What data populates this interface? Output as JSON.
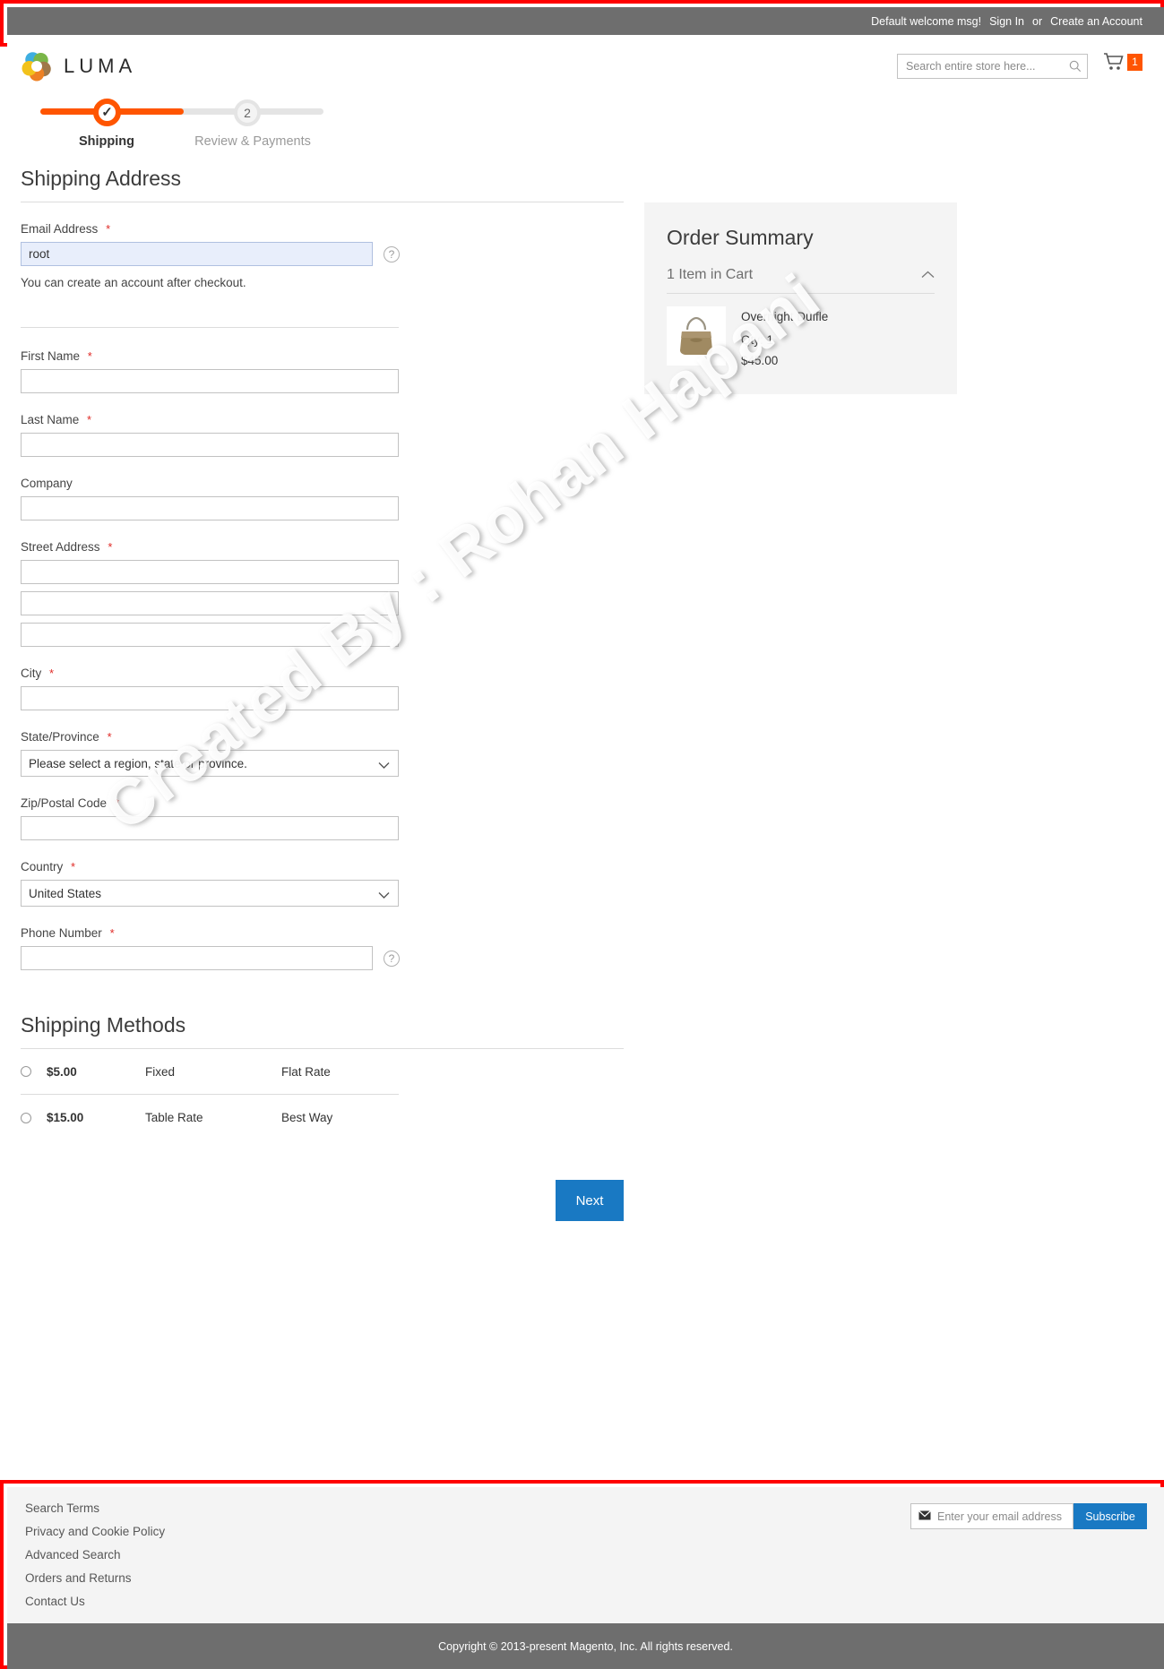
{
  "top_panel": {
    "welcome_message": "Default welcome msg!",
    "sign_in": "Sign In",
    "or": "or",
    "create_account": "Create an Account"
  },
  "header": {
    "logo_text": "LUMA",
    "search_placeholder": "Search entire store here...",
    "search_value": "",
    "cart_count": "1"
  },
  "progress": {
    "step1_label": "Shipping",
    "step1_mark": "✓",
    "step2_label": "Review & Payments",
    "step2_number": "2"
  },
  "shipping_address": {
    "heading": "Shipping Address",
    "email_label": "Email Address",
    "email_value": "root",
    "email_placeholder": "",
    "email_hint": "You can create an account after checkout.",
    "first_name_label": "First Name",
    "first_name_value": "",
    "last_name_label": "Last Name",
    "last_name_value": "",
    "company_label": "Company",
    "company_value": "",
    "street_label": "Street Address",
    "street_line1": "",
    "street_line2": "",
    "street_line3": "",
    "city_label": "City",
    "city_value": "",
    "state_label": "State/Province",
    "state_value": "Please select a region, state or province.",
    "zip_label": "Zip/Postal Code",
    "zip_value": "",
    "country_label": "Country",
    "country_value": "United States",
    "phone_label": "Phone Number",
    "phone_value": "",
    "required_marker": "*"
  },
  "shipping_methods": {
    "heading": "Shipping Methods",
    "rows": [
      {
        "price": "$5.00",
        "carrier": "Fixed",
        "method": "Flat Rate",
        "selected": false
      },
      {
        "price": "$15.00",
        "carrier": "Table Rate",
        "method": "Best Way",
        "selected": false
      }
    ]
  },
  "actions": {
    "next_label": "Next"
  },
  "order_summary": {
    "title": "Order Summary",
    "item_count_text": "1 Item in Cart",
    "product_name": "Overnight Duffle",
    "product_qty": "Qty: 1",
    "product_price": "$45.00"
  },
  "watermark": {
    "text": "Created By : Rohan Hapani"
  },
  "footer": {
    "links": [
      "Search Terms",
      "Privacy and Cookie Policy",
      "Advanced Search",
      "Orders and Returns",
      "Contact Us"
    ],
    "newsletter_placeholder": "Enter your email address",
    "newsletter_value": "",
    "subscribe_label": "Subscribe",
    "copyright": "Copyright © 2013-present Magento, Inc. All rights reserved."
  },
  "colors": {
    "accent_orange": "#ff5501",
    "button_blue": "#1979c3",
    "panel_gray": "#6e6e6e",
    "annotation_red": "#ff0000"
  }
}
